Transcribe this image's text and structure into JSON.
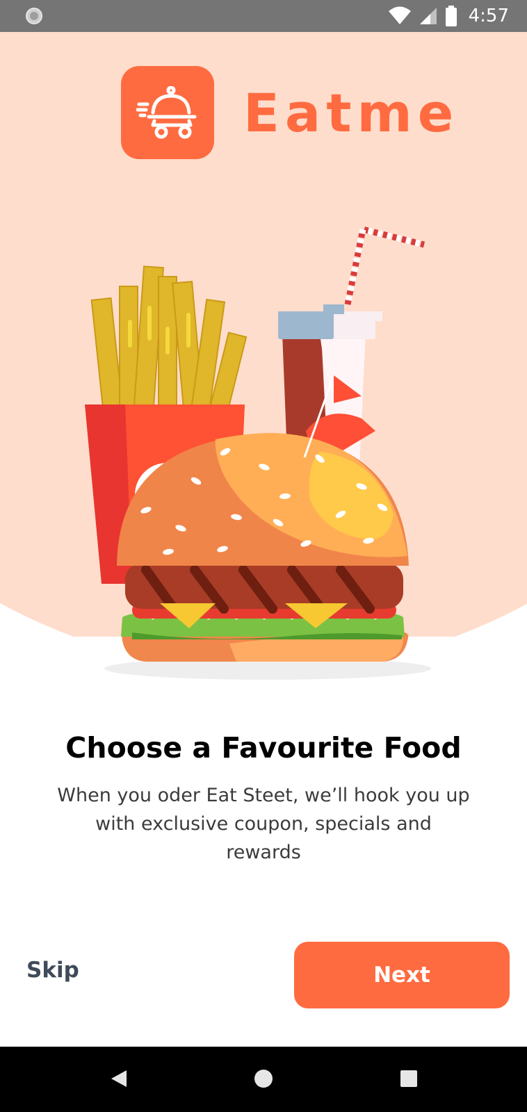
{
  "status_bar": {
    "time": "4:57",
    "icons": [
      "circle-notification-icon",
      "wifi-icon",
      "cellular-signal-icon",
      "battery-icon"
    ]
  },
  "brand": {
    "name": "Eatme",
    "logo_icon": "food-delivery-cart-icon",
    "accent_color": "#ff6b40",
    "hero_bg_color": "#ffddcc"
  },
  "illustration": {
    "subject": "burger-fries-drink-illustration"
  },
  "onboarding": {
    "title": "Choose a Favourite Food",
    "description": "When you oder Eat Steet, we’ll hook you up with exclusive coupon, specials and rewards"
  },
  "actions": {
    "skip_label": "Skip",
    "next_label": "Next"
  },
  "nav_bar": {
    "icons": [
      "back-icon",
      "home-icon",
      "recents-icon"
    ]
  }
}
